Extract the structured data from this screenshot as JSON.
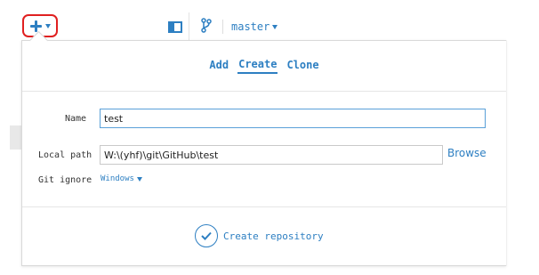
{
  "toolbar": {
    "add_icon": "plus-icon",
    "add_caret_icon": "chevron-down-icon",
    "sidebar_icon": "sidebar-toggle-icon",
    "branch_icon": "git-branch-icon",
    "branch_name": "master",
    "accent_color": "#2d7fc2",
    "highlight_color": "#e02020"
  },
  "panel": {
    "tabs": [
      {
        "label": "Add",
        "active": false
      },
      {
        "label": "Create",
        "active": true
      },
      {
        "label": "Clone",
        "active": false
      }
    ],
    "name_label": "Name",
    "name_value": "test",
    "local_path_label": "Local path",
    "local_path_value": "W:\\(yhf)\\git\\GitHub\\test",
    "browse_label": "Browse",
    "git_ignore_label": "Git ignore",
    "git_ignore_value": "Windows",
    "create_button_label": "Create repository",
    "create_button_icon": "check-circle-icon"
  }
}
